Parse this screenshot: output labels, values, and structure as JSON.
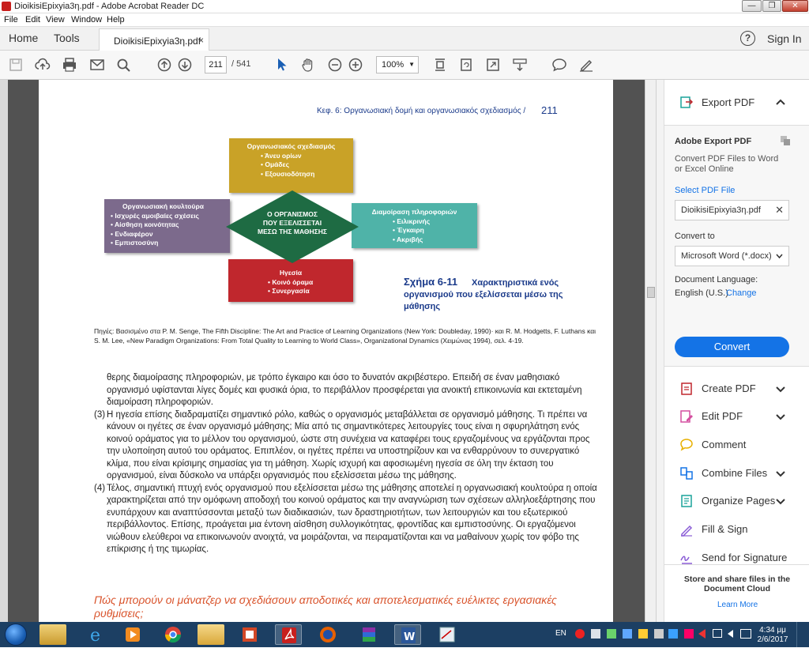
{
  "window": {
    "title": "DioikisiEpixyia3η.pdf - Adobe Acrobat Reader DC",
    "minimize": "—",
    "maximize": "❐",
    "close": "✕"
  },
  "menu": [
    "File",
    "Edit",
    "View",
    "Window",
    "Help"
  ],
  "tabs": {
    "home": "Home",
    "tools": "Tools",
    "doc": "DioikisiEpixyia3η.pdf",
    "doc_close": "×",
    "help": "?",
    "signin": "Sign In"
  },
  "toolbar": {
    "page_current": "211",
    "page_total": "/ 541",
    "zoom": "100%",
    "zoom_arrow": "▼"
  },
  "page": {
    "header": "Κεφ. 6: Οργανωσιακή δομή και οργανωσιακός σχεδιασμός  /",
    "page_number": "211",
    "figure": {
      "design": {
        "title": "Οργανωσιακός σχεδιασμός",
        "items": [
          "• Άνευ ορίων",
          "• Ομάδες",
          "• Εξουσιοδότηση"
        ],
        "color": "#c9a227"
      },
      "culture": {
        "title": "Οργανωσιακή κουλτούρα",
        "items": [
          "• Ισχυρές αμοιβαίες σχέσεις",
          "• Αίσθηση κοινότητας",
          "• Ενδιαφέρον",
          "• Εμπιστοσύνη"
        ],
        "color": "#7c6a8c"
      },
      "center": {
        "line1": "Ο ΟΡΓΑΝΙΣΜΟΣ",
        "line2": "ΠΟΥ ΕΞΕΛΙΣΣΕΤΑΙ",
        "line3": "ΜΕΣΩ ΤΗΣ ΜΑΘΗΣΗΣ",
        "color": "#1e6b43"
      },
      "sharing": {
        "title": "Διαμοίραση πληροφοριών",
        "items": [
          "• Ειλικρινής",
          "• Έγκαιρη",
          "• Ακριβής"
        ],
        "color": "#4fb3a8"
      },
      "leadership": {
        "title": "Ηγεσία",
        "items": [
          "• Κοινό όραμα",
          "• Συνεργασία"
        ],
        "color": "#c0272d"
      }
    },
    "caption_label": "Σχήμα 6-11",
    "caption_text": "Χαρακτηριστικά ενός οργανισμού που εξελίσσεται μέσω της μάθησης",
    "sources": "Πηγές: Βασισμένο στα P. M. Senge, The Fifth Discipline: The Art and Practice of Learning Organizations (New York: Doubleday, 1990)· και R. M. Hodgetts, F. Luthans και S. M. Lee, «New Paradigm Organizations: From Total Quality to Learning to World Class», Organizational Dynamics (Χειμώνας 1994), σελ. 4-19.",
    "para_cont": "θερης διαμοίρασης πληροφοριών, με τρόπο έγκαιρο και όσο το δυνατόν ακριβέστερο. Επειδή σε έναν μαθησιακό οργανισμό υφίστανται λίγες δομές και φυσικά όρια, το περιβάλλον προσφέρεται για ανοικτή επικοινωνία και εκτεταμένη διαμοίραση πληροφοριών.",
    "para3_num": "(3)",
    "para3": "Η ηγεσία επίσης διαδραματίζει σημαντικό ρόλο, καθώς ο οργανισμός μεταβάλλεται σε οργανισμό μάθησης. Τι πρέπει να κάνουν οι ηγέτες σε έναν οργανισμό μάθησης; Μία από τις σημαντικότερες λειτουργίες τους είναι η σφυρηλάτηση ενός κοινού οράματος για το μέλλον του οργανισμού, ώστε στη συνέχεια να καταφέρει τους εργαζομένους να εργάζονται προς την υλοποίηση αυτού του οράματος. Επιπλέον, οι ηγέτες πρέπει να υποστηρίζουν και να ενθαρρύνουν το συνεργατικό κλίμα, που είναι κρίσιμης σημασίας για τη μάθηση. Χωρίς ισχυρή και αφοσιωμένη ηγεσία σε όλη την έκταση του οργανισμού, είναι δύσκολο να υπάρξει οργανισμός που εξελίσσεται μέσω της μάθησης.",
    "para4_num": "(4)",
    "para4": "Τέλος, σημαντική πτυχή ενός οργανισμού που εξελίσσεται μέσω της μάθησης αποτελεί η οργανωσιακή κουλτούρα η οποία χαρακτηρίζεται από την ομόφωνη αποδοχή του κοινού οράματος και την αναγνώριση των σχέσεων αλληλοεξάρτησης που ενυπάρχουν και αναπτύσσονται μεταξύ των διαδικασιών, των δραστηριοτήτων, των λειτουργιών και του εξωτερικού περιβάλλοντος. Επίσης, προάγεται μια έντονη αίσθηση συλλογικότητας, φροντίδας και εμπιστοσύνης. Οι εργαζόμενοι νιώθουν ελεύθεροι να επικοινωνούν ανοιχτά, να μοιράζονται, να πειραματίζονται και να μαθαίνουν χωρίς τον φόβο της επίκρισης ή της τιμωρίας.",
    "section_heading": "Πώς μπορούν οι μάνατζερ να σχεδιάσουν αποδοτικές και αποτελεσματικές ευέλικτες εργασιακές ρυθμίσεις;"
  },
  "panel": {
    "export_title": "Export PDF",
    "adobe_export": "Adobe Export PDF",
    "desc": "Convert PDF Files to Word or Excel Online",
    "select": "Select PDF File",
    "file": "DioikisiEpixyia3η.pdf",
    "convert_to": "Convert to",
    "format": "Microsoft Word (*.docx)",
    "lang_label": "Document Language:",
    "lang_value": "English (U.S.)",
    "change": "Change",
    "convert_btn": "Convert",
    "tools": [
      "Create PDF",
      "Edit PDF",
      "Comment",
      "Combine Files",
      "Organize Pages",
      "Fill & Sign",
      "Send for Signature"
    ],
    "footer1": "Store and share files in the Document Cloud",
    "learn_more": "Learn More"
  },
  "taskbar": {
    "lang": "EN",
    "time": "4:34 μμ",
    "date": "2/6/2017"
  }
}
